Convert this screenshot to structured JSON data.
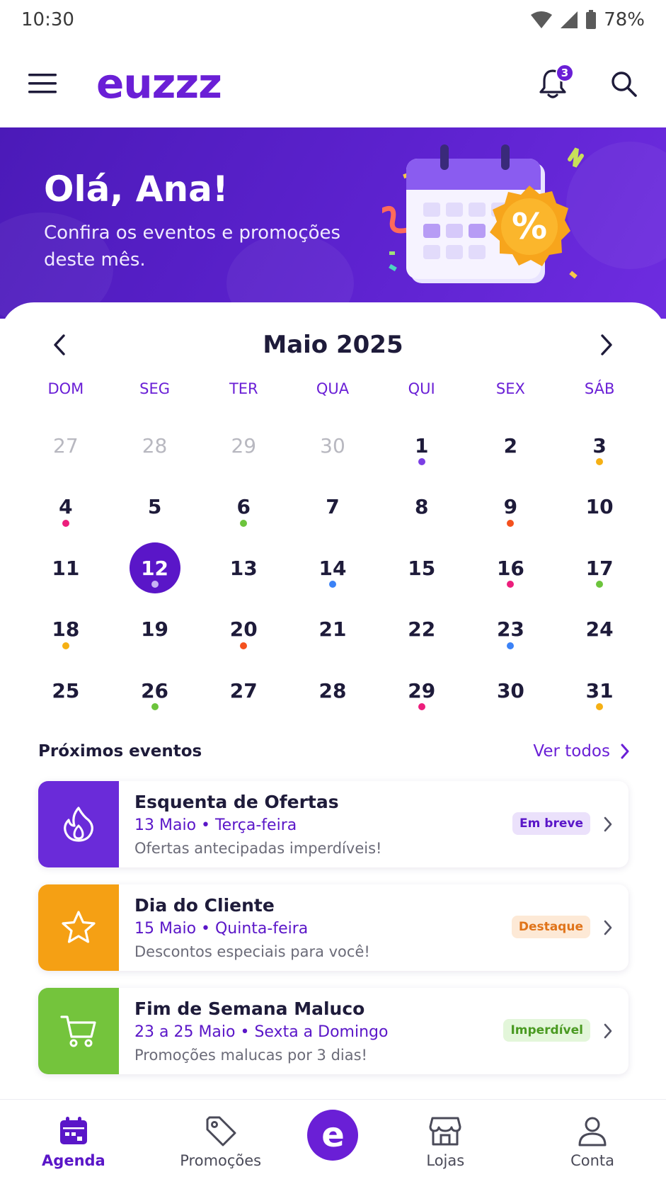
{
  "status_bar": {
    "time": "10:30",
    "battery": "78%"
  },
  "header": {
    "logo": "euzzz",
    "notification_count": "3"
  },
  "hero": {
    "title": "Olá, Ana!",
    "subtitle": "Confira os eventos e promoções deste mês."
  },
  "calendar": {
    "title": "Maio 2025",
    "weekdays": [
      "DOM",
      "SEG",
      "TER",
      "QUA",
      "QUI",
      "SEX",
      "SÁB"
    ],
    "days": [
      {
        "n": "27",
        "muted": true
      },
      {
        "n": "28",
        "muted": true
      },
      {
        "n": "29",
        "muted": true
      },
      {
        "n": "30",
        "muted": true
      },
      {
        "n": "1",
        "dot": "#7b3fe4"
      },
      {
        "n": "2"
      },
      {
        "n": "3",
        "dot": "#f5b014"
      },
      {
        "n": "4",
        "dot": "#ec1e7c"
      },
      {
        "n": "5"
      },
      {
        "n": "6",
        "dot": "#6cc43c"
      },
      {
        "n": "7"
      },
      {
        "n": "8"
      },
      {
        "n": "9",
        "dot": "#f4511e"
      },
      {
        "n": "10"
      },
      {
        "n": "11"
      },
      {
        "n": "12",
        "selected": true,
        "dot": "#c7b3f5"
      },
      {
        "n": "13"
      },
      {
        "n": "14",
        "dot": "#3b82f6"
      },
      {
        "n": "15"
      },
      {
        "n": "16",
        "dot": "#ec1e7c"
      },
      {
        "n": "17",
        "dot": "#6cc43c"
      },
      {
        "n": "18",
        "dot": "#f5b014"
      },
      {
        "n": "19"
      },
      {
        "n": "20",
        "dot": "#f4511e"
      },
      {
        "n": "21"
      },
      {
        "n": "22"
      },
      {
        "n": "23",
        "dot": "#3b82f6"
      },
      {
        "n": "24"
      },
      {
        "n": "25"
      },
      {
        "n": "26",
        "dot": "#6cc43c"
      },
      {
        "n": "27"
      },
      {
        "n": "28"
      },
      {
        "n": "29",
        "dot": "#ec1e7c"
      },
      {
        "n": "30"
      },
      {
        "n": "31",
        "dot": "#f5b014"
      }
    ]
  },
  "upcoming": {
    "title": "Próximos eventos",
    "see_all": "Ver todos",
    "events": [
      {
        "title": "Esquenta de Ofertas",
        "date": "13 Maio • Terça-feira",
        "description": "Ofertas antecipadas imperdíveis!",
        "badge": "Em breve",
        "icon": "flame-icon",
        "color": "#6a2bd9",
        "badge_bg": "#ebe1fb",
        "badge_fg": "#5a16c8"
      },
      {
        "title": "Dia do Cliente",
        "date": "15 Maio • Quinta-feira",
        "description": "Descontos especiais para você!",
        "badge": "Destaque",
        "icon": "star-icon",
        "color": "#f5a014",
        "badge_bg": "#fde9d6",
        "badge_fg": "#e0741a"
      },
      {
        "title": "Fim de Semana Maluco",
        "date": "23 a 25 Maio • Sexta a Domingo",
        "description": "Promoções malucas por 3 dias!",
        "badge": "Imperdível",
        "icon": "cart-icon",
        "color": "#74c43c",
        "badge_bg": "#e3f6da",
        "badge_fg": "#4a9a22"
      }
    ]
  },
  "bottom_nav": {
    "items": [
      "Agenda",
      "Promoções",
      "Lojas",
      "Conta"
    ],
    "center_label": "e"
  },
  "colors": {
    "brand": "#6a1fd6",
    "brand_dark": "#4b1ab8"
  }
}
